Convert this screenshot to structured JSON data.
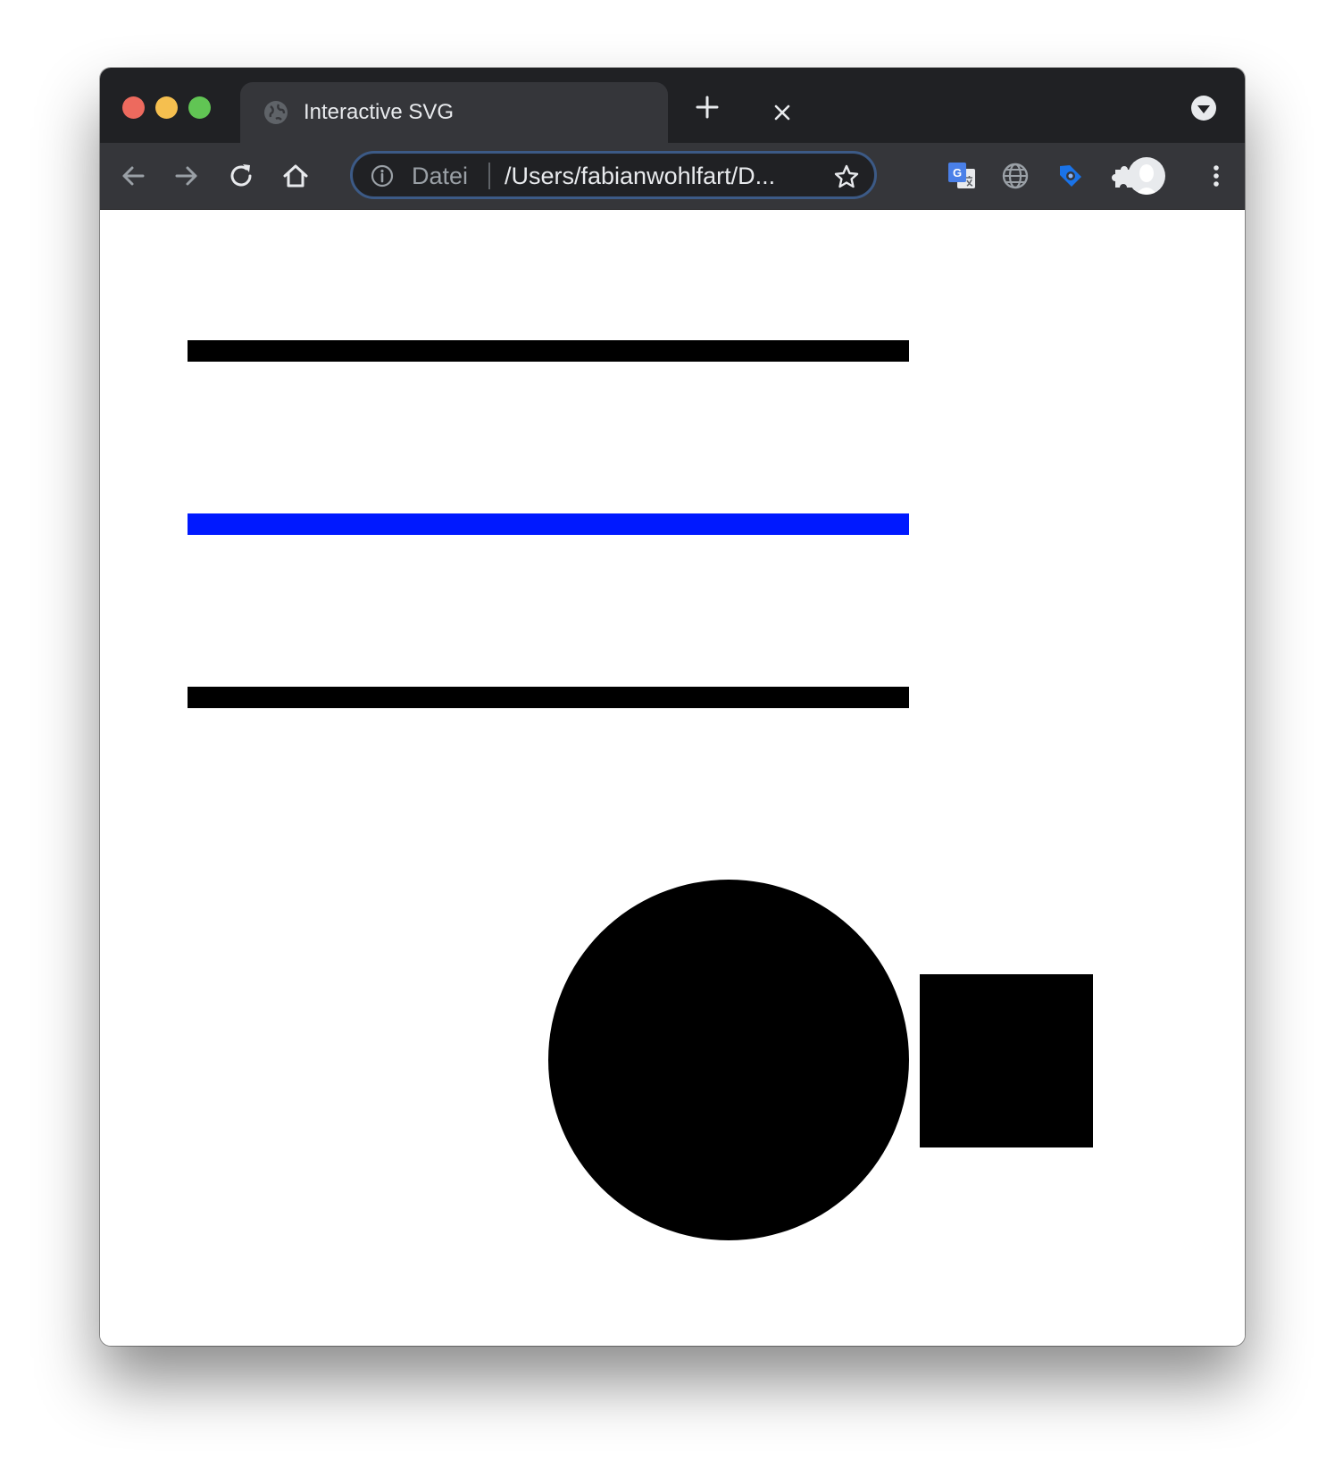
{
  "browser": {
    "tab": {
      "title": "Interactive SVG"
    },
    "omnibox": {
      "scheme_label": "Datei",
      "url": "/Users/fabianwohlfart/D..."
    },
    "icons": {
      "traffic_close": "close-window-icon",
      "traffic_minimize": "minimize-window-icon",
      "traffic_zoom": "zoom-window-icon",
      "favicon": "globe-icon",
      "tab_close": "close-icon",
      "new_tab": "plus-icon",
      "tab_search": "chevron-down-icon",
      "back": "arrow-left-icon",
      "forward": "arrow-right-icon",
      "reload": "reload-icon",
      "home": "home-icon",
      "info": "info-icon",
      "bookmark": "star-icon",
      "translate": "translate-icon",
      "language": "globe-icon",
      "tag": "tag-icon",
      "extensions": "puzzle-icon",
      "profile": "avatar",
      "menu": "kebab-menu-icon"
    },
    "colors": {
      "frame": "#202124",
      "toolbar": "#35363a",
      "traffic_red": "#ed6a5e",
      "traffic_yellow": "#f5bf4f",
      "traffic_green": "#61c554"
    }
  },
  "canvas": {
    "lines": [
      {
        "name": "line-1",
        "color": "#000000"
      },
      {
        "name": "line-2",
        "color": "#0019ff"
      },
      {
        "name": "line-3",
        "color": "#000000"
      }
    ],
    "circle": {
      "color": "#000000"
    },
    "square": {
      "color": "#000000"
    }
  }
}
